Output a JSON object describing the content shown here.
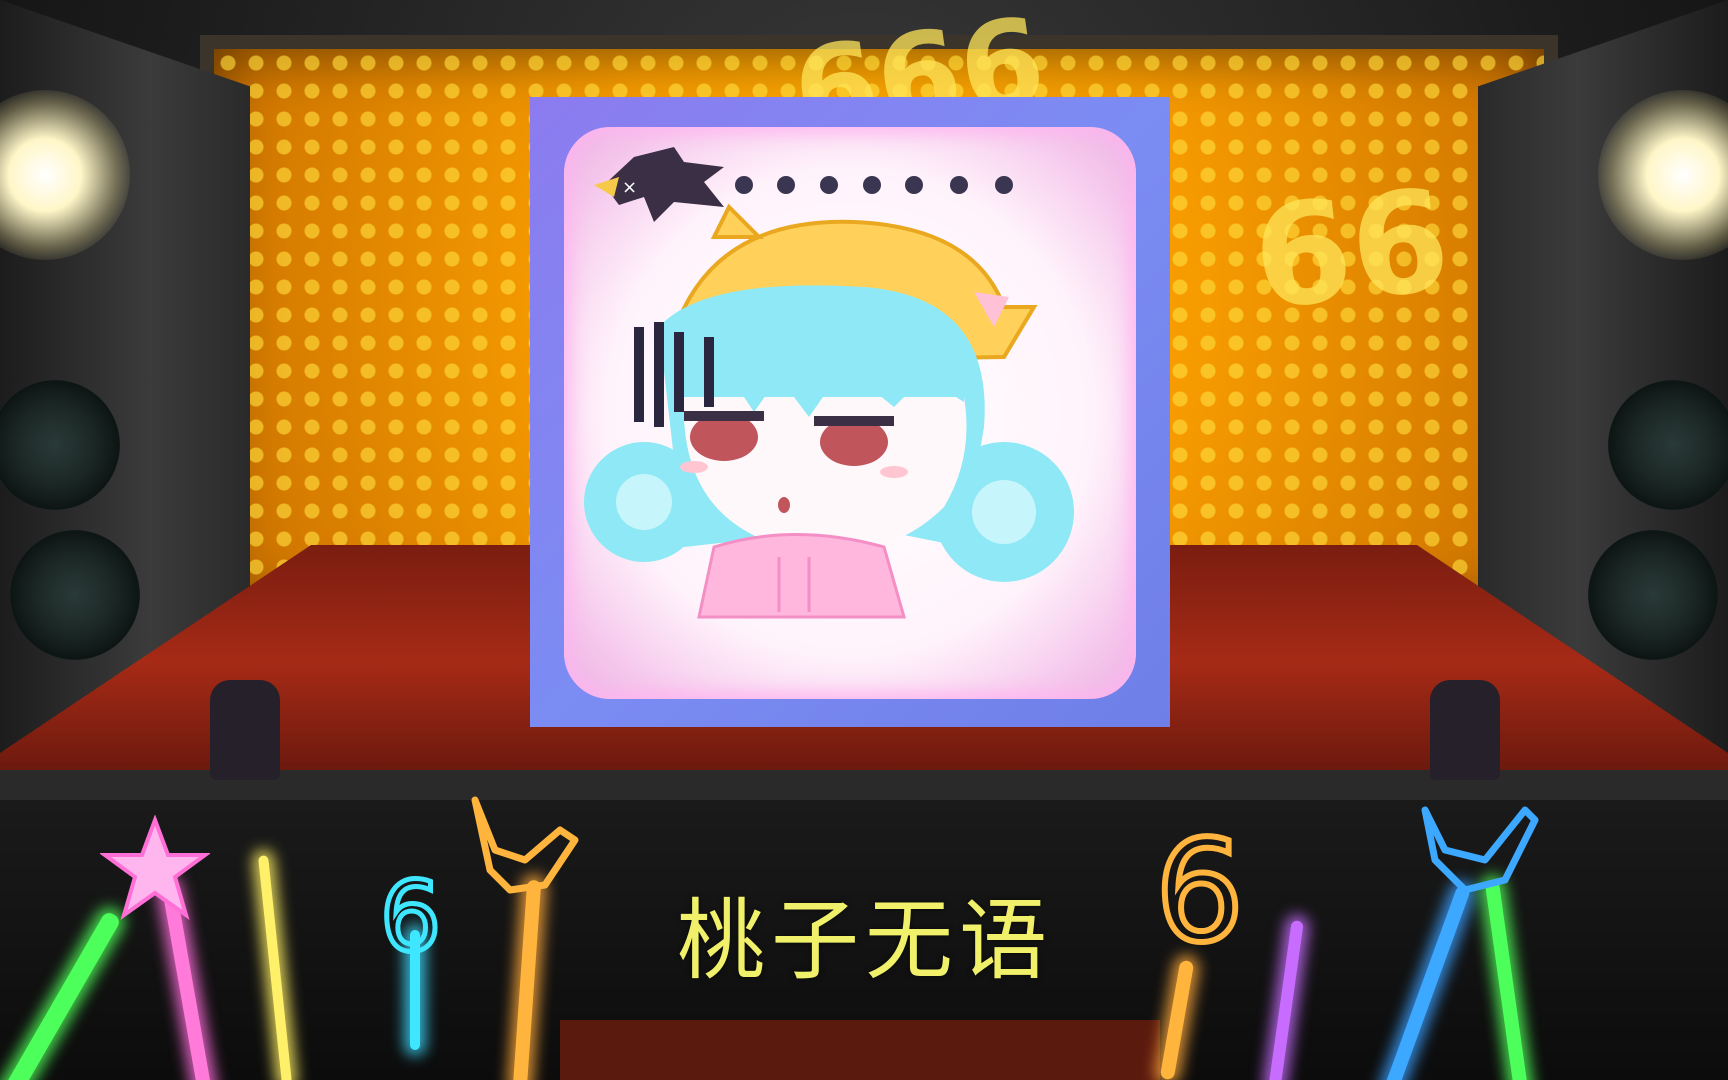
{
  "scene": {
    "caption": "桃子无语",
    "wall_text_top": "666",
    "wall_text_right": "66"
  },
  "emote": {
    "name": "peach-speechless",
    "dots": 7,
    "colors": {
      "card_border": "#7b8cf3",
      "hair": "#8ee8f5",
      "hat": "#ffd15a",
      "hoodie": "#ffb7dd"
    }
  },
  "colors": {
    "backdrop": "#f59a00",
    "stage_floor": "#a62a16",
    "caption": "#f0f06a"
  }
}
